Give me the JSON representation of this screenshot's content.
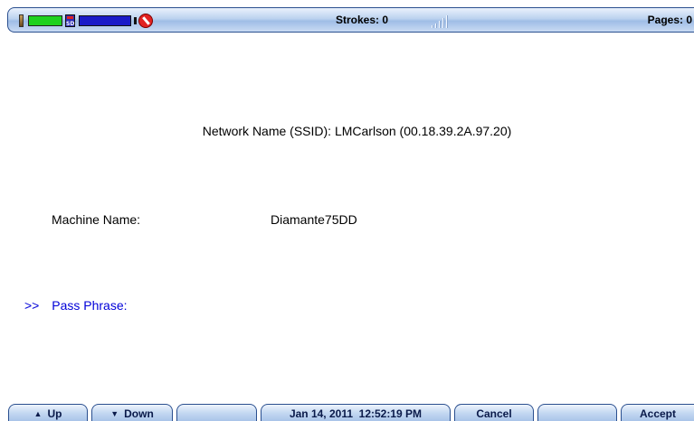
{
  "status_bar": {
    "strokes_text": "Strokes: 0",
    "pages_text": "Pages: 0",
    "icons": [
      "battery-small-icon",
      "battery-level-bar",
      "sd-card-icon",
      "storage-level-bar",
      "no-phone-icon",
      "signal-strength-icon"
    ],
    "colors": {
      "battery_fill": "#1fd11f",
      "storage_fill": "#1a1ac8",
      "no_phone": "#e22222"
    }
  },
  "main": {
    "ssid_text": "Network Name (SSID): LMCarlson (00.18.39.2A.97.20)",
    "machine_name_label": "Machine Name:",
    "machine_name_value": "Diamante75DD",
    "pass_phrase_arrow": ">>",
    "pass_phrase_label": "Pass Phrase:",
    "pass_phrase_value": "",
    "highlight_color": "#0000d8"
  },
  "softkeys": {
    "up_symbol": "▲",
    "up_label": "Up",
    "down_symbol": "▼",
    "down_label": "Down",
    "blank1_label": "",
    "datetime": "Jan 14, 2011  12:52:19 PM",
    "cancel_label": "Cancel",
    "blank2_label": "",
    "accept_label": "Accept"
  }
}
